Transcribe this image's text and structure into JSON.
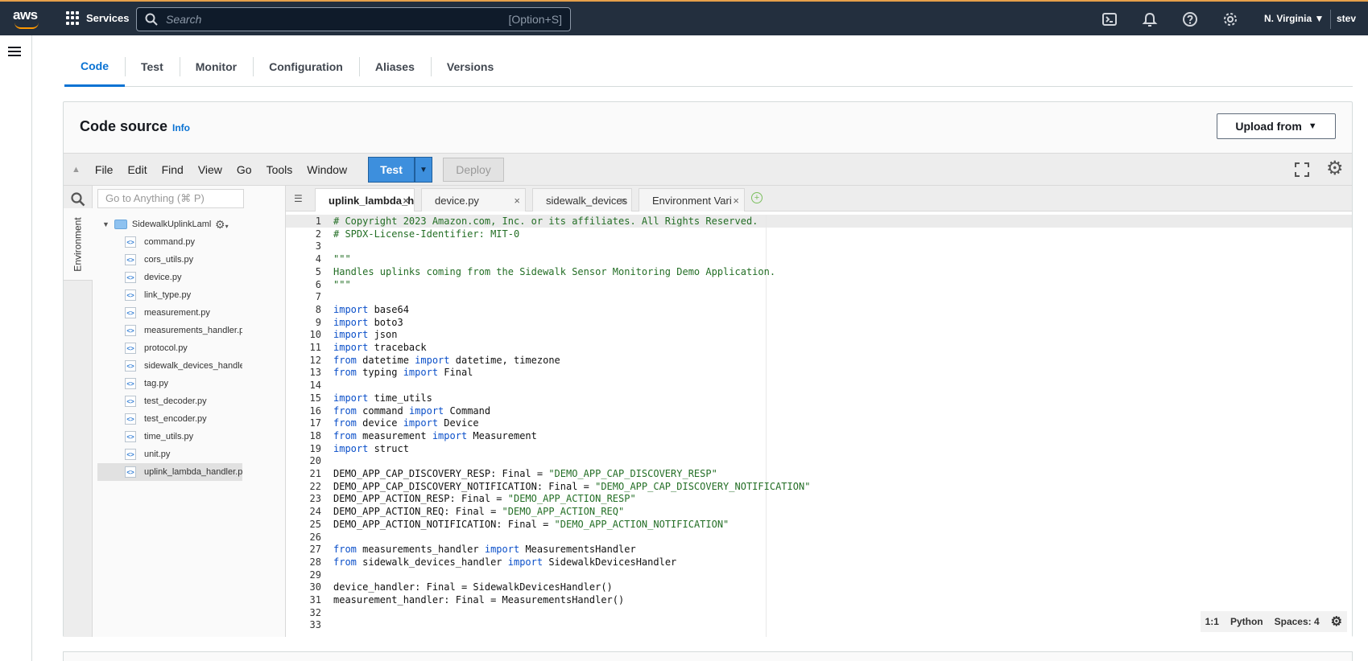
{
  "topbar": {
    "logo_text": "aws",
    "services_label": "Services",
    "search_placeholder": "Search",
    "search_shortcut": "[Option+S]",
    "region_label": "N. Virginia",
    "user_label": "stev"
  },
  "tabs": [
    "Code",
    "Test",
    "Monitor",
    "Configuration",
    "Aliases",
    "Versions"
  ],
  "code_source": {
    "title": "Code source",
    "info_label": "Info",
    "upload_label": "Upload from"
  },
  "menubar": {
    "items": [
      "File",
      "Edit",
      "Find",
      "View",
      "Go",
      "Tools",
      "Window"
    ],
    "test_label": "Test",
    "deploy_label": "Deploy"
  },
  "sidebar": {
    "env_label": "Environment",
    "goto_placeholder": "Go to Anything (⌘ P)",
    "folder_name": "SidewalkUplinkLaml",
    "files": [
      "command.py",
      "cors_utils.py",
      "device.py",
      "link_type.py",
      "measurement.py",
      "measurements_handler.p",
      "protocol.py",
      "sidewalk_devices_handle",
      "tag.py",
      "test_decoder.py",
      "test_encoder.py",
      "time_utils.py",
      "unit.py",
      "uplink_lambda_handler.p"
    ],
    "selected_file": "uplink_lambda_handler.p"
  },
  "editor_tabs": [
    "uplink_lambda_h",
    "device.py",
    "sidewalk_devices",
    "Environment Vari"
  ],
  "code_lines": [
    {
      "n": "1",
      "t": "# Copyright 2023 Amazon.com, Inc. or its affiliates. All Rights Reserved."
    },
    {
      "n": "2",
      "t": "# SPDX-License-Identifier: MIT-0"
    },
    {
      "n": "3",
      "t": ""
    },
    {
      "n": "4",
      "t": "\"\"\""
    },
    {
      "n": "5",
      "t": "Handles uplinks coming from the Sidewalk Sensor Monitoring Demo Application."
    },
    {
      "n": "6",
      "t": "\"\"\""
    },
    {
      "n": "7",
      "t": ""
    },
    {
      "n": "8",
      "t": "import base64"
    },
    {
      "n": "9",
      "t": "import boto3"
    },
    {
      "n": "10",
      "t": "import json"
    },
    {
      "n": "11",
      "t": "import traceback"
    },
    {
      "n": "12",
      "t": "from datetime import datetime, timezone"
    },
    {
      "n": "13",
      "t": "from typing import Final"
    },
    {
      "n": "14",
      "t": ""
    },
    {
      "n": "15",
      "t": "import time_utils"
    },
    {
      "n": "16",
      "t": "from command import Command"
    },
    {
      "n": "17",
      "t": "from device import Device"
    },
    {
      "n": "18",
      "t": "from measurement import Measurement"
    },
    {
      "n": "19",
      "t": "import struct"
    },
    {
      "n": "20",
      "t": ""
    },
    {
      "n": "21",
      "t": "DEMO_APP_CAP_DISCOVERY_RESP: Final = \"DEMO_APP_CAP_DISCOVERY_RESP\""
    },
    {
      "n": "22",
      "t": "DEMO_APP_CAP_DISCOVERY_NOTIFICATION: Final = \"DEMO_APP_CAP_DISCOVERY_NOTIFICATION\""
    },
    {
      "n": "23",
      "t": "DEMO_APP_ACTION_RESP: Final = \"DEMO_APP_ACTION_RESP\""
    },
    {
      "n": "24",
      "t": "DEMO_APP_ACTION_REQ: Final = \"DEMO_APP_ACTION_REQ\""
    },
    {
      "n": "25",
      "t": "DEMO_APP_ACTION_NOTIFICATION: Final = \"DEMO_APP_ACTION_NOTIFICATION\""
    },
    {
      "n": "26",
      "t": ""
    },
    {
      "n": "27",
      "t": "from measurements_handler import MeasurementsHandler"
    },
    {
      "n": "28",
      "t": "from sidewalk_devices_handler import SidewalkDevicesHandler"
    },
    {
      "n": "29",
      "t": ""
    },
    {
      "n": "30",
      "t": "device_handler: Final = SidewalkDevicesHandler()"
    },
    {
      "n": "31",
      "t": "measurement_handler: Final = MeasurementsHandler()"
    },
    {
      "n": "32",
      "t": ""
    },
    {
      "n": "33",
      "t": ""
    }
  ],
  "status": {
    "cursor": "1:1",
    "language": "Python",
    "spaces": "Spaces: 4"
  }
}
